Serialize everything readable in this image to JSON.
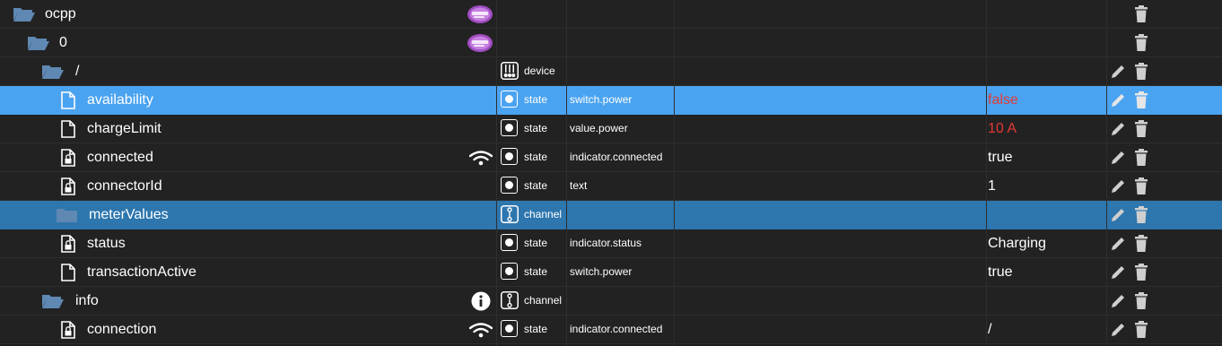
{
  "rows": [
    {
      "name": "ocpp",
      "type": "",
      "role": "",
      "value": "",
      "value_color": "",
      "icon": "folder-open-icon",
      "side_icon": "ocpp-logo-icon",
      "editable": false
    },
    {
      "name": "0",
      "type": "",
      "role": "",
      "value": "",
      "value_color": "",
      "icon": "folder-open-icon",
      "side_icon": "ocpp-logo-icon",
      "editable": false
    },
    {
      "name": "/",
      "type": "device",
      "role": "",
      "value": "",
      "value_color": "",
      "icon": "folder-open-icon",
      "side_icon": "",
      "editable": true
    },
    {
      "name": "availability",
      "type": "state",
      "role": "switch.power",
      "value": "false",
      "value_color": "#e53935",
      "icon": "file-icon",
      "side_icon": "",
      "editable": true
    },
    {
      "name": "chargeLimit",
      "type": "state",
      "role": "value.power",
      "value": "10 A",
      "value_color": "#e53935",
      "icon": "file-icon",
      "side_icon": "",
      "editable": true
    },
    {
      "name": "connected",
      "type": "state",
      "role": "indicator.connected",
      "value": "true",
      "value_color": "",
      "icon": "file-lock-icon",
      "side_icon": "wifi-icon",
      "editable": true
    },
    {
      "name": "connectorId",
      "type": "state",
      "role": "text",
      "value": "1",
      "value_color": "",
      "icon": "file-lock-icon",
      "side_icon": "",
      "editable": true
    },
    {
      "name": "meterValues",
      "type": "channel",
      "role": "",
      "value": "",
      "value_color": "",
      "icon": "folder-closed-icon",
      "side_icon": "",
      "editable": true
    },
    {
      "name": "status",
      "type": "state",
      "role": "indicator.status",
      "value": "Charging",
      "value_color": "",
      "icon": "file-lock-icon",
      "side_icon": "",
      "editable": true
    },
    {
      "name": "transactionActive",
      "type": "state",
      "role": "switch.power",
      "value": "true",
      "value_color": "",
      "icon": "file-icon",
      "side_icon": "",
      "editable": true
    },
    {
      "name": "info",
      "type": "channel",
      "role": "",
      "value": "",
      "value_color": "",
      "icon": "folder-open-icon",
      "side_icon": "info-icon",
      "editable": true
    },
    {
      "name": "connection",
      "type": "state",
      "role": "indicator.connected",
      "value": "/",
      "value_color": "",
      "icon": "file-lock-icon",
      "side_icon": "wifi-icon",
      "editable": true
    }
  ],
  "colors": {
    "background": "#222222",
    "selected_row": "#4aa3f0",
    "highlight_row": "#2d76ae",
    "folder": "#5f88b3",
    "error_value": "#e53935"
  }
}
